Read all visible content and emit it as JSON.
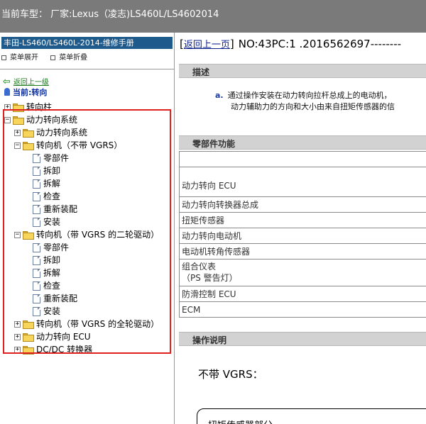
{
  "header": {
    "title": "当前车型： 厂家:Lexus（凌志)LS460L/LS4602014"
  },
  "sidebar": {
    "manual_title": "丰田-LS460/LS460L-2014-维修手册",
    "expand_label": "菜单展开",
    "collapse_label": "菜单折叠",
    "back_label": "返回上一级",
    "current_label": "当前:转向",
    "tree": [
      {
        "label": "转向柱",
        "type": "folder",
        "toggle": "+"
      },
      {
        "label": "动力转向系统",
        "type": "folder",
        "toggle": "-"
      },
      {
        "label": "动力转向系统",
        "type": "folder",
        "toggle": "+"
      },
      {
        "label": "转向机（不带 VGRS）",
        "type": "folder",
        "toggle": "-"
      },
      {
        "label": "零部件",
        "type": "doc"
      },
      {
        "label": "拆卸",
        "type": "doc"
      },
      {
        "label": "拆解",
        "type": "doc"
      },
      {
        "label": "检查",
        "type": "doc"
      },
      {
        "label": "重新装配",
        "type": "doc"
      },
      {
        "label": "安装",
        "type": "doc"
      },
      {
        "label": "转向机（带 VGRS 的二轮驱动）",
        "type": "folder",
        "toggle": "-"
      },
      {
        "label": "零部件",
        "type": "doc"
      },
      {
        "label": "拆卸",
        "type": "doc"
      },
      {
        "label": "拆解",
        "type": "doc"
      },
      {
        "label": "检查",
        "type": "doc"
      },
      {
        "label": "重新装配",
        "type": "doc"
      },
      {
        "label": "安装",
        "type": "doc"
      },
      {
        "label": "转向机（带 VGRS 的全轮驱动）",
        "type": "folder",
        "toggle": "+"
      },
      {
        "label": "动力转向 ECU",
        "type": "folder",
        "toggle": "+"
      },
      {
        "label": "DC/DC 转换器",
        "type": "folder",
        "toggle": "+"
      }
    ]
  },
  "main": {
    "back_link": "返回上一页",
    "doc_code": "NO:43PC:1 .2016562697--------",
    "describe_title": "描述",
    "describe_label": "a.",
    "describe_line1": "通过操作安装在动力转向拉杆总成上的电动机，",
    "describe_line2": "动力辅助力的方向和大小由来自扭矩传感器的信",
    "parts_title": "零部件功能",
    "parts": [
      "",
      "动力转向 ECU",
      "动力转向转换器总成",
      "扭矩传感器",
      "动力转向电动机",
      "电动机转角传感器",
      "组合仪表\n（PS 警告灯）",
      "防滑控制 ECU",
      "ECM"
    ],
    "ops_title": "操作说明",
    "note": "不带 VGRS：",
    "box_text": "扭矩传感器部分"
  },
  "colors": {
    "titlebar": "#7a7a7a",
    "manual_head": "#1f5a8c",
    "highlight_box": "#e0201c",
    "section_bar": "#d2d2d2"
  }
}
